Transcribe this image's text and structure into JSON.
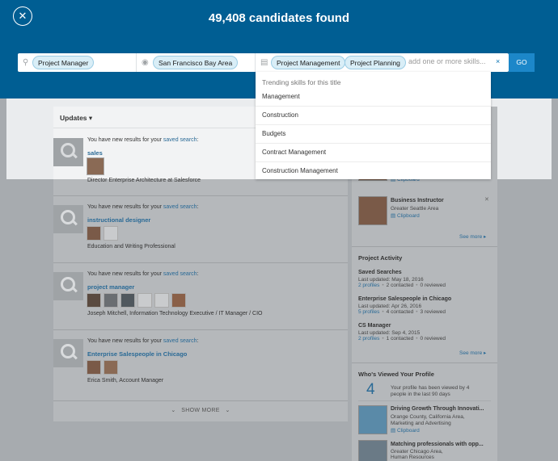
{
  "header": {
    "title": "49,408 candidates found",
    "close_icon": "close-icon"
  },
  "search": {
    "title_pill": "Project Manager",
    "location_pill": "San Francisco Bay Area",
    "skill_pills": [
      "Project Management",
      "Project Planning"
    ],
    "skill_placeholder": "add one or more skills...",
    "clear_label": "×",
    "go_label": "GO"
  },
  "dropdown": {
    "title": "Trending skills for this title",
    "items": [
      "Management",
      "Construction",
      "Budgets",
      "Contract Management",
      "Construction Management"
    ]
  },
  "updates": {
    "label": "Updates ▾",
    "items": [
      {
        "prefix": "You have new results for your ",
        "link": "saved search",
        "suffix": ":",
        "search": "sales",
        "person": "Director Enterprise Architecture at Salesforce"
      },
      {
        "prefix": "You have new results for your ",
        "link": "saved search",
        "suffix": ":",
        "search": "instructional designer",
        "person": "Education and Writing Professional"
      },
      {
        "prefix": "You have new results for your ",
        "link": "saved search",
        "suffix": ":",
        "search": "project manager",
        "person": "Joseph Mitchell, Information Technology Executive / IT Manager / CIO"
      },
      {
        "prefix": "You have new results for your ",
        "link": "saved search",
        "suffix": ":",
        "search": "Enterprise Salespeople in Chicago",
        "person": "Erica Smith, Account Manager"
      }
    ],
    "show_more": "SHOW MORE"
  },
  "right": {
    "clipboard_top": "Clipboard",
    "instructor": {
      "name": "Business Instructor",
      "location": "Greater Seattle Area",
      "clip": "Clipboard"
    },
    "see_more": "See more ▸",
    "project_activity": {
      "title": "Project Activity",
      "items": [
        {
          "name": "Saved Searches",
          "updated": "Last updated: May 18, 2016",
          "profiles": "2 profiles",
          "contacted": "2 contacted",
          "reviewed": "0 reviewed"
        },
        {
          "name": "Enterprise Salespeople in Chicago",
          "updated": "Last updated: Apr 26, 2016",
          "profiles": "5 profiles",
          "contacted": "4 contacted",
          "reviewed": "3 reviewed"
        },
        {
          "name": "CS Manager",
          "updated": "Last updated: Sep 4, 2015",
          "profiles": "2 profiles",
          "contacted": "1 contacted",
          "reviewed": "0 reviewed"
        }
      ],
      "see_more": "See more ▸"
    },
    "viewed": {
      "title": "Who's Viewed Your Profile",
      "count": "4",
      "line1": "Your profile has been viewed by 4",
      "line2": "people in the last 90 days",
      "people": [
        {
          "name": "Driving Growth Through Innovati...",
          "l1": "Orange County, California Area,",
          "l2": "Marketing and Advertising",
          "clip": "Clipboard"
        },
        {
          "name": "Matching professionals with opp...",
          "l1": "Greater Chicago Area,",
          "l2": "Human Resources"
        }
      ]
    }
  }
}
